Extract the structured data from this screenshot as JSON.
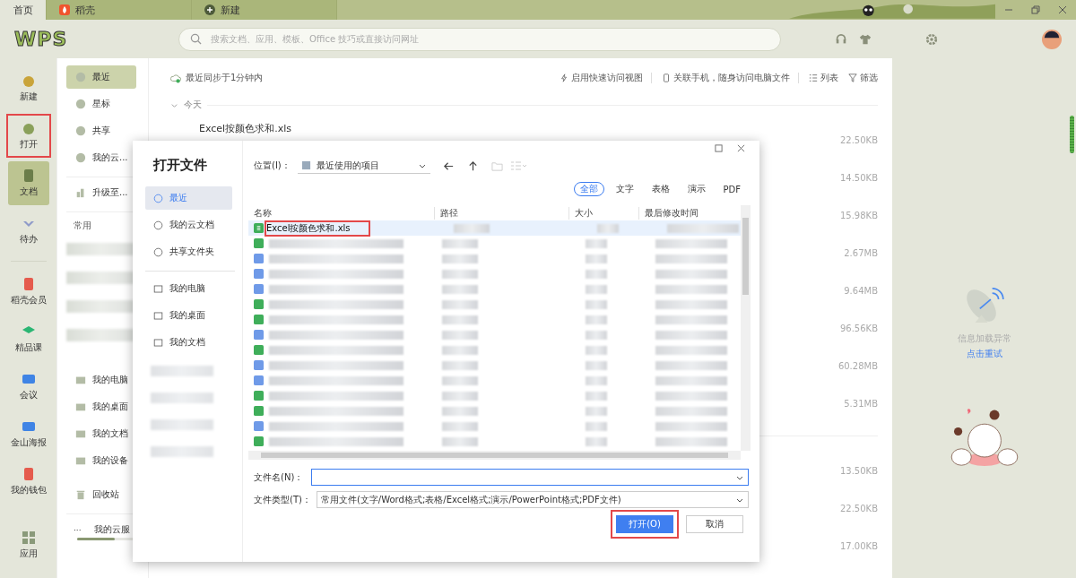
{
  "tabs": [
    {
      "label": "首页",
      "selected": true
    },
    {
      "label": "稻壳",
      "selected": false
    },
    {
      "label": "新建",
      "selected": false
    }
  ],
  "header": {
    "logo": "WPS",
    "search": {
      "placeholder": "搜索文档、应用、模板、Office 技巧或直接访问网址"
    }
  },
  "nav": [
    {
      "label": "新建",
      "selected": false,
      "highlighted": false
    },
    {
      "label": "打开",
      "selected": false,
      "highlighted": true
    },
    {
      "label": "文档",
      "selected": true,
      "highlighted": false
    },
    {
      "label": "待办",
      "selected": false,
      "highlighted": false
    },
    {
      "label": "稻壳会员",
      "selected": false,
      "highlighted": false
    },
    {
      "label": "精品课",
      "selected": false,
      "highlighted": false
    },
    {
      "label": "会议",
      "selected": false,
      "highlighted": false
    },
    {
      "label": "金山海报",
      "selected": false,
      "highlighted": false
    },
    {
      "label": "我的钱包",
      "selected": false,
      "highlighted": false
    }
  ],
  "nav_bottom": {
    "label": "应用"
  },
  "sidebar": {
    "top": [
      {
        "label": "最近",
        "selected": true
      },
      {
        "label": "星标",
        "selected": false
      },
      {
        "label": "共享",
        "selected": false
      },
      {
        "label": "我的云...",
        "selected": false
      }
    ],
    "upgrade": "升级至...",
    "common_title": "常用",
    "places": [
      {
        "label": "我的电脑"
      },
      {
        "label": "我的桌面"
      },
      {
        "label": "我的文档"
      },
      {
        "label": "我的设备"
      }
    ],
    "trash": "回收站",
    "cloud": {
      "more": "...",
      "label": "我的云服",
      "level": 0.6
    }
  },
  "main": {
    "sync": "最近同步于1分钟内",
    "actions": [
      {
        "kind": "quick",
        "label": "启用快速访问视图"
      },
      {
        "kind": "phone",
        "label": "关联手机，随身访问电脑文件"
      },
      {
        "kind": "list",
        "label": "列表"
      },
      {
        "kind": "filter",
        "label": "筛选"
      }
    ],
    "groups": [
      {
        "title": "今天",
        "rows": [
          {
            "name": "Excel按颜色求和.xls",
            "size": "22.50KB"
          },
          {
            "size": "14.50KB"
          },
          {
            "size": "15.98KB"
          },
          {
            "size": "2.67MB"
          },
          {
            "size": "9.64MB"
          },
          {
            "size": "96.56KB"
          },
          {
            "size": "60.28MB"
          },
          {
            "size": "5.31MB"
          }
        ]
      },
      {
        "rows": [
          {
            "size": "13.50KB"
          },
          {
            "size": "22.50KB"
          },
          {
            "size": "17.00KB"
          }
        ]
      }
    ]
  },
  "right_panel": {
    "message": "信息加载异常",
    "retry": "点击重试"
  },
  "dialog": {
    "title": "打开文件",
    "nav": [
      {
        "label": "最近",
        "selected": true
      },
      {
        "label": "我的云文档",
        "selected": false
      },
      {
        "label": "共享文件夹",
        "selected": false
      }
    ],
    "places": [
      {
        "label": "我的电脑"
      },
      {
        "label": "我的桌面"
      },
      {
        "label": "我的文档"
      }
    ],
    "location_label": "位置(I)：",
    "location": "最近使用的项目",
    "filters": [
      {
        "label": "全部",
        "selected": true
      },
      {
        "label": "文字",
        "selected": false
      },
      {
        "label": "表格",
        "selected": false
      },
      {
        "label": "演示",
        "selected": false
      },
      {
        "label": "PDF",
        "selected": false
      }
    ],
    "columns": [
      "名称",
      "路径",
      "大小",
      "最后修改时间"
    ],
    "rows": [
      {
        "kind": "file",
        "name": "Excel按颜色求和.xls",
        "selected": true,
        "highlighted": true,
        "color": "#3fae5a"
      },
      {
        "kind": "blurred",
        "color": "#3fae5a"
      },
      {
        "kind": "blurred",
        "color": "#6f9ae8"
      },
      {
        "kind": "blurred",
        "color": "#6f9ae8"
      },
      {
        "kind": "blurred",
        "color": "#6f9ae8"
      },
      {
        "kind": "blurred",
        "color": "#3fae5a"
      },
      {
        "kind": "blurred",
        "color": "#3fae5a"
      },
      {
        "kind": "blurred",
        "color": "#6f9ae8"
      },
      {
        "kind": "blurred",
        "color": "#3fae5a"
      },
      {
        "kind": "blurred",
        "color": "#6f9ae8"
      },
      {
        "kind": "blurred",
        "color": "#6f9ae8"
      },
      {
        "kind": "blurred",
        "color": "#3fae5a"
      },
      {
        "kind": "blurred",
        "color": "#3fae5a"
      },
      {
        "kind": "blurred",
        "color": "#6f9ae8"
      },
      {
        "kind": "blurred",
        "color": "#3fae5a"
      }
    ],
    "filename_label": "文件名(N)：",
    "filetype_label": "文件类型(T)：",
    "filetype": "常用文件(文字/Word格式;表格/Excel格式;演示/PowerPoint格式;PDF文件)",
    "buttons": [
      {
        "kind": "primary",
        "label": "打开(O)",
        "highlighted": true
      },
      {
        "kind": "secondary",
        "label": "取消",
        "highlighted": false
      }
    ]
  }
}
